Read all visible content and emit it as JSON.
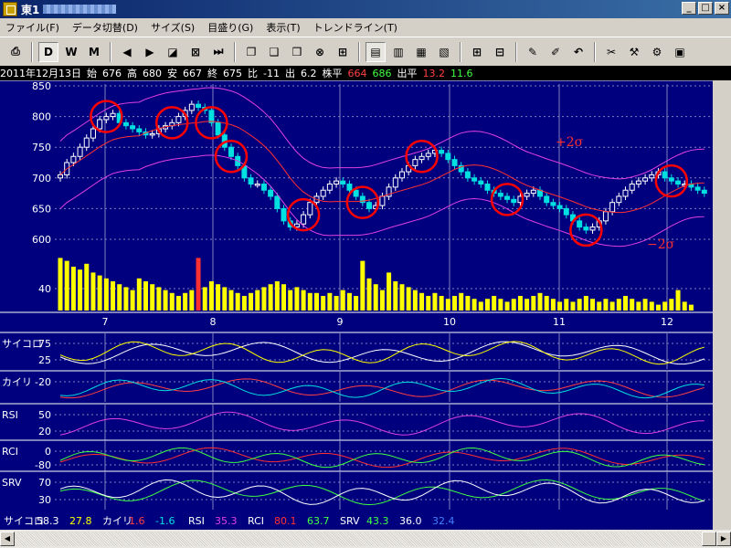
{
  "window": {
    "title": "東1",
    "buttons": [
      "_",
      "□",
      "×"
    ]
  },
  "menu": [
    "ファイル(F)",
    "データ切替(D)",
    "サイズ(S)",
    "目盛り(G)",
    "表示(T)",
    "トレンドライン(T)"
  ],
  "toolbar": {
    "buttons": [
      {
        "name": "print-icon",
        "glyph": "⎙"
      },
      {
        "name": "daily-button",
        "glyph": "D",
        "pressed": true
      },
      {
        "name": "weekly-button",
        "glyph": "W"
      },
      {
        "name": "monthly-button",
        "glyph": "M"
      },
      {
        "name": "arrow-left-icon",
        "glyph": "◀"
      },
      {
        "name": "arrow-right-icon",
        "glyph": "▶"
      },
      {
        "name": "zoom-box-icon",
        "glyph": "◪"
      },
      {
        "name": "fit-icon",
        "glyph": "⊠"
      },
      {
        "name": "end-icon",
        "glyph": "⏭"
      },
      {
        "name": "window-icon-1",
        "glyph": "❐"
      },
      {
        "name": "window-icon-2",
        "glyph": "❑"
      },
      {
        "name": "window-icon-3",
        "glyph": "❒"
      },
      {
        "name": "cross-icon",
        "glyph": "⊗"
      },
      {
        "name": "split-icon",
        "glyph": "⊞"
      },
      {
        "name": "layout-icon-1",
        "glyph": "▤",
        "pressed": true
      },
      {
        "name": "layout-icon-2",
        "glyph": "▥"
      },
      {
        "name": "layout-icon-3",
        "glyph": "▦"
      },
      {
        "name": "layout-icon-4",
        "glyph": "▧"
      },
      {
        "name": "grid-icon-1",
        "glyph": "⊞"
      },
      {
        "name": "grid-icon-2",
        "glyph": "⊟"
      },
      {
        "name": "pen-icon",
        "glyph": "✎"
      },
      {
        "name": "pen-disabled-icon",
        "glyph": "✐"
      },
      {
        "name": "undo-icon",
        "glyph": "↶"
      },
      {
        "name": "tool-icon-1",
        "glyph": "✂"
      },
      {
        "name": "tool-icon-2",
        "glyph": "⚒"
      },
      {
        "name": "tool-icon-3",
        "glyph": "⚙"
      },
      {
        "name": "chart-print-icon",
        "glyph": "▣"
      }
    ]
  },
  "info": {
    "date": "2011年12月13日",
    "open_label": "始",
    "open": "676",
    "high_label": "高",
    "high": "680",
    "low_label": "安",
    "low": "667",
    "close_label": "終",
    "close": "675",
    "change_label": "比",
    "change": "-11",
    "volume_label": "出",
    "volume": "6.2",
    "avg_label": "株平",
    "avg1": "664",
    "avg2": "686",
    "avgvol_label": "出平",
    "avgvol1": "13.2",
    "avgvol2": "11.6"
  },
  "colors": {
    "bg": "#00007f",
    "candle_up": "#ffffff",
    "candle_down": "#00e0e0",
    "ma": "#ff3030",
    "band": "#e040e0",
    "volume": "#ffff00",
    "circle": "#ff0000",
    "grid": "#7f7fbf"
  },
  "chart_data": {
    "type": "candlestick",
    "y_ticks": [
      "850",
      "800",
      "750",
      "700",
      "650",
      "600"
    ],
    "volume_tick": "40",
    "x_ticks": [
      "7",
      "8",
      "9",
      "10",
      "11",
      "12"
    ],
    "annotations": [
      "+2σ",
      "−2σ"
    ],
    "closes": [
      705,
      725,
      735,
      750,
      765,
      780,
      795,
      800,
      805,
      790,
      785,
      780,
      775,
      770,
      772,
      780,
      785,
      790,
      800,
      810,
      820,
      815,
      810,
      790,
      770,
      750,
      735,
      720,
      700,
      690,
      690,
      680,
      670,
      650,
      630,
      620,
      625,
      640,
      660,
      670,
      680,
      690,
      695,
      690,
      680,
      670,
      660,
      650,
      655,
      670,
      685,
      700,
      710,
      720,
      730,
      735,
      740,
      745,
      740,
      730,
      720,
      710,
      700,
      695,
      690,
      680,
      675,
      670,
      665,
      660,
      670,
      675,
      680,
      670,
      660,
      655,
      650,
      640,
      630,
      620,
      615,
      620,
      630,
      645,
      660,
      670,
      680,
      690,
      695,
      700,
      705,
      710,
      700,
      695,
      690,
      690,
      685,
      680,
      675
    ],
    "volumes": [
      36,
      34,
      30,
      28,
      32,
      26,
      24,
      22,
      20,
      18,
      16,
      14,
      22,
      20,
      18,
      16,
      14,
      12,
      10,
      12,
      14,
      36,
      16,
      20,
      18,
      16,
      14,
      12,
      10,
      12,
      14,
      16,
      18,
      20,
      18,
      14,
      16,
      14,
      12,
      12,
      10,
      12,
      10,
      14,
      12,
      10,
      34,
      22,
      18,
      14,
      26,
      20,
      18,
      16,
      14,
      12,
      10,
      12,
      10,
      8,
      10,
      12,
      10,
      8,
      6,
      8,
      10,
      8,
      6,
      8,
      10,
      8,
      10,
      12,
      10,
      8,
      6,
      8,
      6,
      8,
      10,
      8,
      6,
      8,
      6,
      8,
      10,
      8,
      6,
      8,
      6,
      4,
      6,
      8,
      14,
      6,
      4
    ],
    "circled_index": [
      7,
      17,
      23,
      26,
      37,
      46,
      55,
      68,
      80,
      93
    ],
    "panels": [
      {
        "label": "サイコロ",
        "ticks": [
          "75",
          "25"
        ]
      },
      {
        "label": "カイリ",
        "ticks": [
          "-20"
        ]
      },
      {
        "label": "RSI",
        "ticks": [
          "50",
          "20"
        ]
      },
      {
        "label": "RCI",
        "ticks": [
          "0",
          "-80"
        ]
      },
      {
        "label": "SRV",
        "ticks": [
          "70",
          "30"
        ]
      }
    ]
  },
  "legend": [
    {
      "label": "サイコロ",
      "v1": "58.3",
      "v2": "27.8",
      "c1": "#ffffff",
      "c2": "#ffff00"
    },
    {
      "label": "カイリ",
      "v1": "1.6",
      "v2": "-1.6",
      "c1": "#ff4040",
      "c2": "#00e0e0"
    },
    {
      "label": "RSI",
      "v1": "35.3",
      "c1": "#e040e0"
    },
    {
      "label": "RCI",
      "v1": "80.1",
      "v2": "63.7",
      "c1": "#ff3030",
      "c2": "#40ff40"
    },
    {
      "label": "SRV",
      "v1": "43.3",
      "v2": "36.0",
      "v3": "32.4",
      "c1": "#40ff40",
      "c2": "#ffffff",
      "c3": "#4080ff"
    }
  ]
}
